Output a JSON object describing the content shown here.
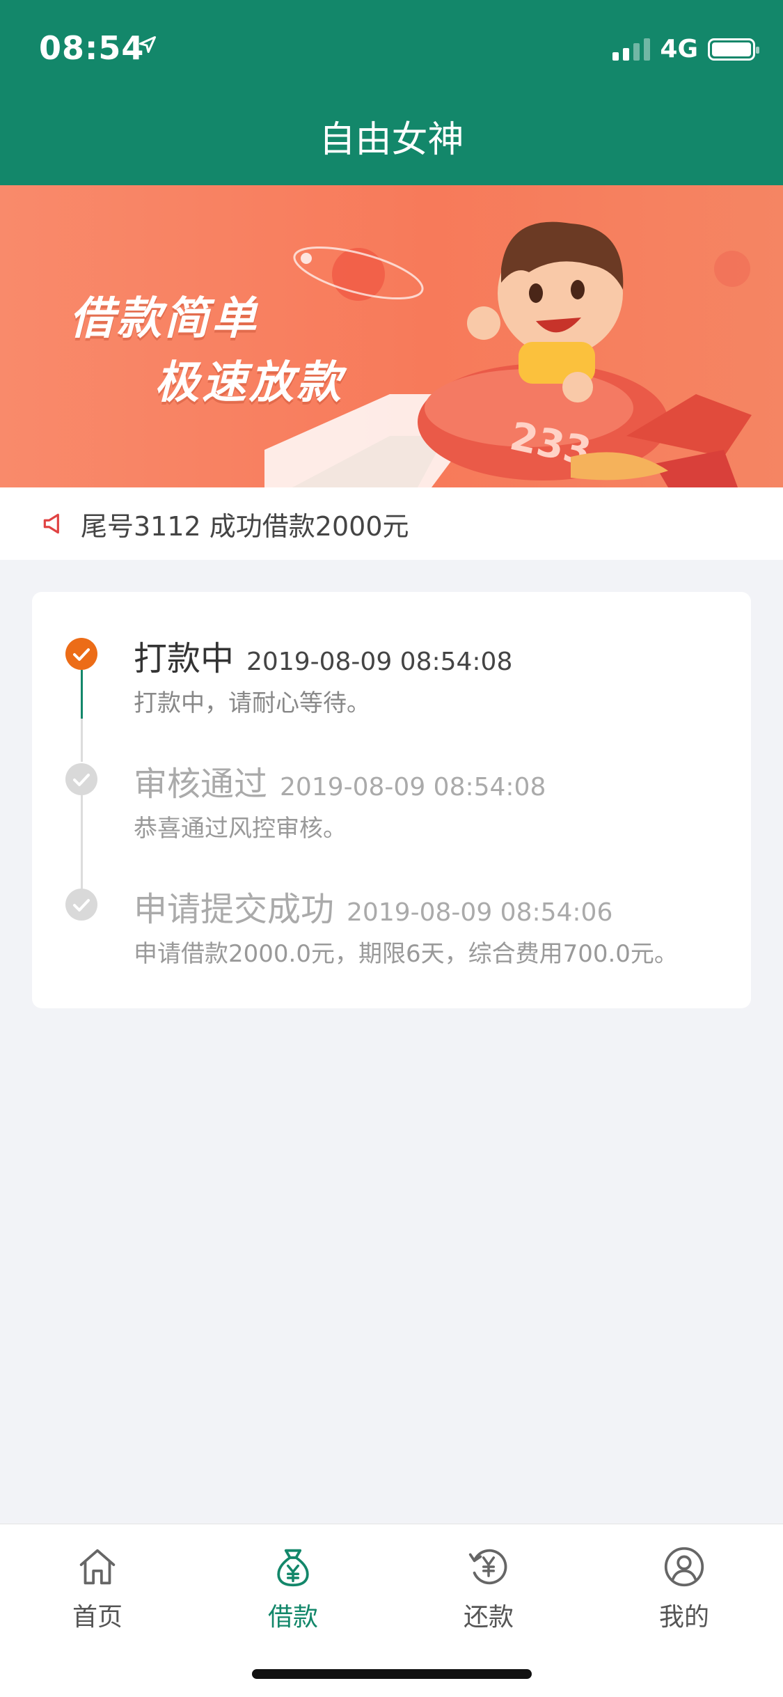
{
  "status_bar": {
    "time": "08:54",
    "network": "4G"
  },
  "header": {
    "title": "自由女神"
  },
  "banner": {
    "line1": "借款简单",
    "line2": "极速放款",
    "plane_number": "233"
  },
  "notice": {
    "text": "尾号3112 成功借款2000元"
  },
  "timeline": [
    {
      "title": "打款中",
      "time": "2019-08-09 08:54:08",
      "desc": "打款中，请耐心等待。",
      "state": "active"
    },
    {
      "title": "审核通过",
      "time": "2019-08-09 08:54:08",
      "desc": "恭喜通过风控审核。",
      "state": "done"
    },
    {
      "title": "申请提交成功",
      "time": "2019-08-09 08:54:06",
      "desc": "申请借款2000.0元，期限6天，综合费用700.0元。",
      "state": "done"
    }
  ],
  "tabbar": [
    {
      "label": "首页",
      "icon": "home-icon",
      "active": false
    },
    {
      "label": "借款",
      "icon": "money-bag-icon",
      "active": true
    },
    {
      "label": "还款",
      "icon": "repay-yen-icon",
      "active": false
    },
    {
      "label": "我的",
      "icon": "user-icon",
      "active": false
    }
  ],
  "colors": {
    "primary": "#13876a",
    "accent": "#ec6c17",
    "background": "#f2f3f7"
  }
}
